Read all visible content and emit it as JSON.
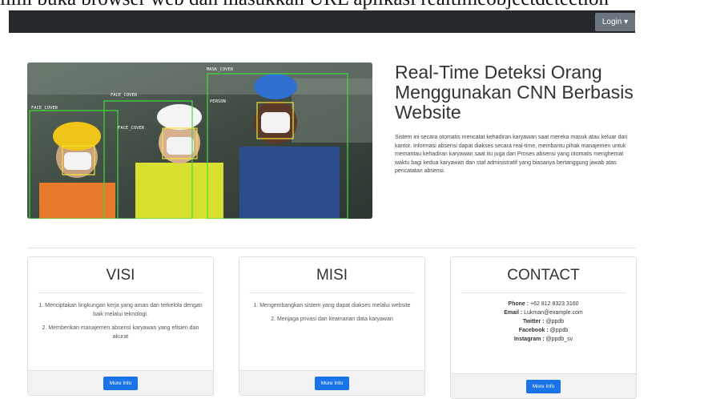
{
  "caption": "ilmi buka browser web dan masukkan URL aplikasi realtimeobjectdetection",
  "navbar": {
    "login_label": "Login ▾"
  },
  "hero": {
    "detection_labels": [
      "MASK_COVER",
      "FACE_COVER",
      "FACE_COVER",
      "FACE_COVER",
      "PERSON"
    ],
    "title": "Real-Time Deteksi Orang Menggunakan CNN Berbasis Website",
    "description": "Sistem ini secara otomatis mencatat kehadiran karyawan saat mereka masuk atau keluar dari kantor. Informasi absensi dapat diakses secara real-time, membantu pihak manajemen untuk memantau kehadiran karyawan saat itu juga dan Proses absensi yang otomatis menghemat waktu bagi kedua karyawan dan staf administratif yang biasanya bertanggung jawab atas pencatatan absensi."
  },
  "visi": {
    "title": "VISI",
    "items": [
      "1. Menciptakan lingkungan kerja yang aman dan terkelola dengan baik melalui teknologi.",
      "2. Memberikan manajemen absensi karyawan yang efisien dan akurat"
    ],
    "button": "More Info"
  },
  "misi": {
    "title": "MISI",
    "items": [
      "1. Mengembangkan sistem yang dapat diakses melalui website",
      "2. Menjaga privasi dan keamanan data karyawan"
    ],
    "button": "More Info"
  },
  "contact": {
    "title": "CONTACT",
    "phone_label": "Phone :",
    "phone": "+62 812 8323 3160",
    "email_label": "Email :",
    "email": "Lukman@example.com",
    "twitter_label": "Twitter :",
    "twitter": "@ppdb",
    "facebook_label": "Facebook :",
    "facebook": "@ppdb",
    "instagram_label": "Instagram :",
    "instagram": "@ppdb_sv",
    "button": "More Info"
  }
}
